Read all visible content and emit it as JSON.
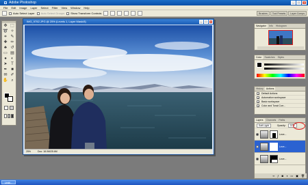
{
  "app": {
    "title": "Adobe Photoshop"
  },
  "menu": [
    "File",
    "Edit",
    "Image",
    "Layer",
    "Select",
    "Filter",
    "View",
    "Window",
    "Help"
  ],
  "options": {
    "auto_select_layer": "Auto Select Layer",
    "auto_select_groups": "Auto Select Groups",
    "show_transform_controls": "Show Transform Controls"
  },
  "palette_well": [
    "Brushes",
    "Tool Presets",
    "Layer Comps"
  ],
  "document": {
    "title": "IMG_9752.JPG @ 25% (Levels 1, Layer Mask/8)",
    "zoom": "25%",
    "doc_info": "Doc: 18.0M/25.6M"
  },
  "navigator": {
    "tabs": [
      "Navigator",
      "Info",
      "Histogram"
    ]
  },
  "color_panel": {
    "tabs": [
      "Color",
      "Swatches",
      "Styles"
    ]
  },
  "actions_panel": {
    "tabs": [
      "History",
      "Actions"
    ],
    "items": [
      "Default Actions",
      "Automation workspace",
      "Basic workspace",
      "Color and Tonal Corr..."
    ]
  },
  "layers_panel": {
    "tabs": [
      "Layers",
      "Channels",
      "Paths"
    ],
    "blend_mode": "Soft Light",
    "opacity_label": "Opacity:",
    "opacity_value": "37%",
    "layers": [
      {
        "name": "Leve..."
      },
      {
        "name": "Leve..."
      },
      {
        "name": "Leve..."
      }
    ]
  },
  "taskbar": {
    "task": "Untitl..."
  },
  "colors": {
    "accent": "#2b62d1",
    "highlight_circle": "#e02020"
  }
}
